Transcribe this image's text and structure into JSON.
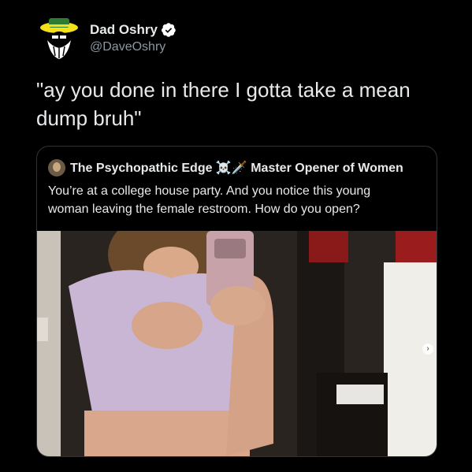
{
  "tweet": {
    "author": {
      "display_name": "Dad Oshry",
      "handle": "@DaveOshry",
      "verified": true
    },
    "text_line1": "\"ay you done in there I gotta take a mean",
    "text_line2": "dump bruh\""
  },
  "quoted_tweet": {
    "author_name": "The Psychopathic Edge ☠️🗡️ Master Opener of Women",
    "text_line1": "You’re at a college house party. And you notice this young",
    "text_line2": "woman leaving the female restroom. How do you open?"
  },
  "colors": {
    "background": "#000000",
    "text": "#e7e9ea",
    "secondary_text": "#8b98a5",
    "verified": "#ffffff",
    "border": "#2f3336",
    "avatar_accent": "#f4e11a"
  },
  "icons": {
    "verified": "verified-badge-icon",
    "avatar": "avatar",
    "carousel": "chevron-right-icon"
  }
}
